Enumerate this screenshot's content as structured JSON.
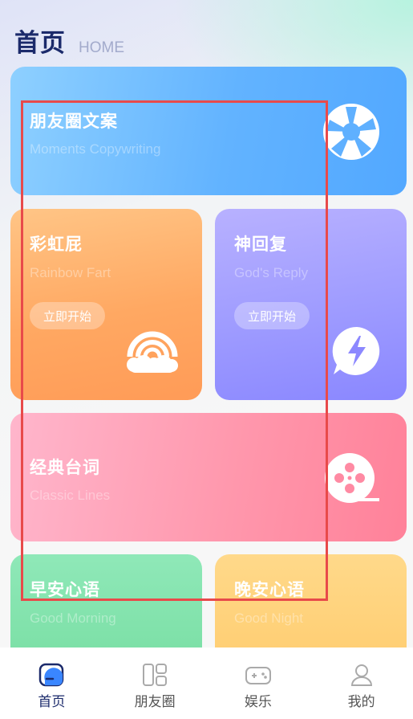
{
  "header": {
    "title": "首页",
    "subtitle": "HOME"
  },
  "cards": {
    "moments": {
      "title": "朋友圈文案",
      "subtitle": "Moments Copywriting"
    },
    "rainbow": {
      "title": "彩虹屁",
      "subtitle": "Rainbow Fart",
      "button": "立即开始"
    },
    "god_reply": {
      "title": "神回复",
      "subtitle": "God's Reply",
      "button": "立即开始"
    },
    "classic": {
      "title": "经典台词",
      "subtitle": "Classic Lines"
    },
    "morning": {
      "title": "早安心语",
      "subtitle": "Good Morning"
    },
    "night": {
      "title": "晚安心语",
      "subtitle": "Good Night"
    }
  },
  "tabbar": {
    "tabs": [
      {
        "label": "首页",
        "icon": "home-icon",
        "active": true
      },
      {
        "label": "朋友圈",
        "icon": "moments-grid-icon",
        "active": false
      },
      {
        "label": "娱乐",
        "icon": "gamepad-icon",
        "active": false
      },
      {
        "label": "我的",
        "icon": "profile-icon",
        "active": false
      }
    ]
  },
  "colors": {
    "title": "#1b2a6b",
    "highlight_border": "#e84a4a",
    "moments": "#62b3ff",
    "rainbow": "#ffa862",
    "god_reply": "#9e9bff",
    "classic": "#ff98ad",
    "morning": "#71db9c",
    "night": "#ffc866"
  }
}
